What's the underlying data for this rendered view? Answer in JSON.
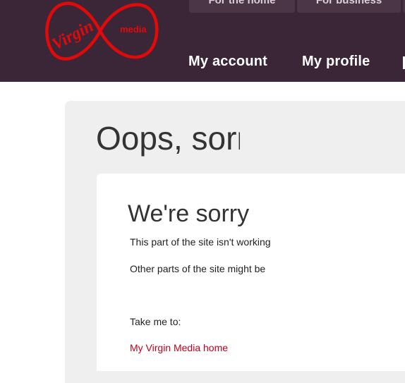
{
  "brand": {
    "logo_script": "Virgin",
    "logo_word": "media",
    "brand_color": "#e10a0a",
    "header_color": "#3a2637"
  },
  "top_tabs": [
    {
      "label": "For the home"
    },
    {
      "label": "For business"
    }
  ],
  "nav": {
    "items": [
      {
        "label": "My account"
      },
      {
        "label": "My profile"
      }
    ]
  },
  "page": {
    "title": "Oops, sorry",
    "card": {
      "heading": "We're sorry",
      "paragraph_1": "This part of the site isn't working",
      "paragraph_2": "Other parts of the site might be",
      "take_me_to": "Take me to:",
      "links": [
        {
          "label": "My Virgin Media home"
        }
      ]
    }
  }
}
